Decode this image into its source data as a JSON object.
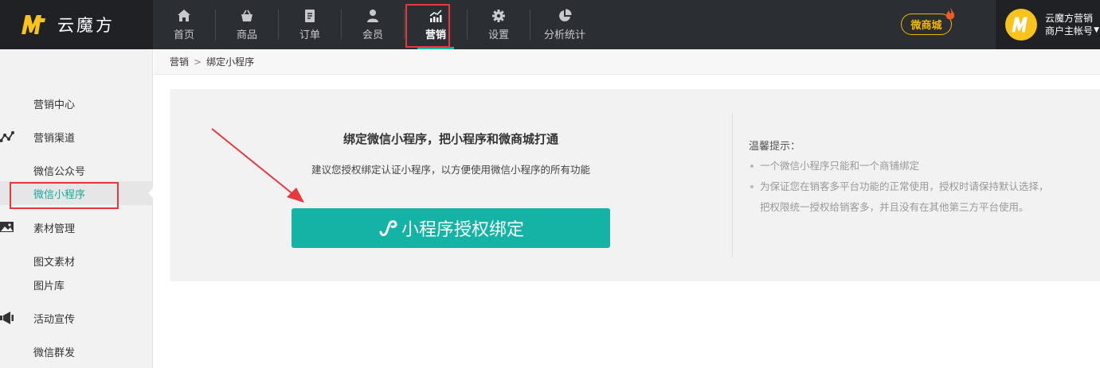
{
  "brand": {
    "name": "云魔方"
  },
  "nav": [
    {
      "label": "首页",
      "icon": "home-icon"
    },
    {
      "label": "商品",
      "icon": "basket-icon"
    },
    {
      "label": "订单",
      "icon": "document-icon"
    },
    {
      "label": "会员",
      "icon": "user-icon"
    },
    {
      "label": "营销",
      "icon": "chart-trend-icon",
      "active": true
    },
    {
      "label": "设置",
      "icon": "gear-icon"
    },
    {
      "label": "分析统计",
      "icon": "pie-chart-icon"
    }
  ],
  "header": {
    "shop_label": "微商城",
    "user_name": "云魔方营销",
    "user_role": "商户主帐号"
  },
  "sidebar": {
    "items": [
      {
        "label": "营销中心"
      },
      {
        "label": "营销渠道",
        "icon": "network-icon"
      },
      {
        "label": "微信公众号"
      },
      {
        "label": "微信小程序",
        "active": true
      },
      {
        "label": "素材管理",
        "icon": "image-icon"
      },
      {
        "label": "图文素材"
      },
      {
        "label": "图片库"
      },
      {
        "label": "活动宣传",
        "icon": "megaphone-icon"
      },
      {
        "label": "微信群发"
      }
    ]
  },
  "breadcrumb": {
    "parent": "营销",
    "current": "绑定小程序"
  },
  "main": {
    "title": "绑定微信小程序，把小程序和微商城打通",
    "subtitle": "建议您授权绑定认证小程序，以方便使用微信小程序的所有功能",
    "bind_button": "小程序授权绑定",
    "tips_title": "温馨提示：",
    "tips": [
      "一个微信小程序只能和一个商铺绑定",
      "为保证您在销客多平台功能的正常使用，授权时请保持默认选择，",
      "把权限统一授权给销客多，并且没有在其他第三方平台使用。"
    ]
  },
  "colors": {
    "accent": "#14b3a6",
    "topbar": "#2b2e33",
    "highlight": "#e8383d",
    "shop_gold": "#f3b600"
  }
}
